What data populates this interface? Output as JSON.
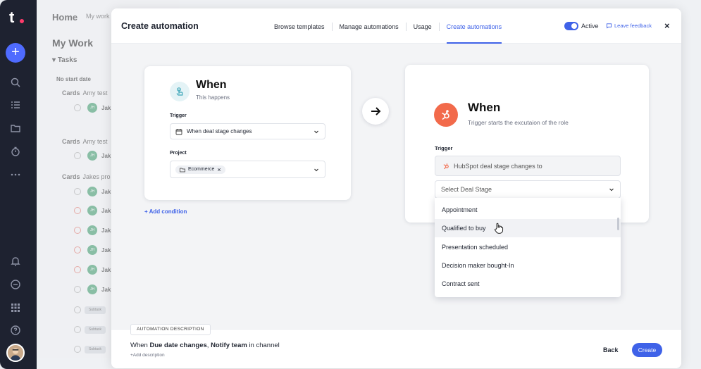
{
  "rail": {
    "logo": "t",
    "plus": "+"
  },
  "background": {
    "home": "Home",
    "my_work_tab": "My work",
    "title": "My Work",
    "tasks_label": "Tasks",
    "no_start_date": "No start date",
    "groups": [
      {
        "label": "Cards",
        "owner": "Amy test"
      },
      {
        "label": "Cards",
        "owner": "Amy test"
      },
      {
        "label": "Cards",
        "owner": "Jakes pro"
      }
    ],
    "initials": "JH",
    "jak": "Jak",
    "subtask": "Subtask"
  },
  "modal": {
    "title": "Create automation",
    "tabs": [
      "Browse templates",
      "Manage automations",
      "Usage",
      "Create automations"
    ],
    "active_tab": "Create automations",
    "active_label": "Active",
    "feedback_label": "Leave feedback",
    "close": "×"
  },
  "when_card": {
    "title": "When",
    "subtitle": "This happens",
    "trigger_label": "Trigger",
    "trigger_value": "When deal stage changes",
    "project_label": "Project",
    "project_chip": "Ecommerce",
    "add_condition": "+ Add condition"
  },
  "hubspot_card": {
    "title": "When",
    "subtitle": "Trigger starts the excutaion of the role",
    "trigger_label": "Trigger",
    "trigger_value": "HubSpot deal stage changes to",
    "select_placeholder": "Select Deal Stage"
  },
  "dropdown": {
    "options": [
      "Appointment",
      "Qualified to buy",
      "Presentation scheduled",
      "Decision maker bought-In",
      "Contract sent"
    ],
    "hovered": "Qualified to buy"
  },
  "footer": {
    "tag": "AUTOMATION DESCRIPTION",
    "desc_prefix": "When",
    "desc_trigger": "Due date changes",
    "desc_sep": ",",
    "desc_action": "Notify team",
    "desc_suffix": "in channel",
    "add_description": "+Add description",
    "back": "Back",
    "create": "Create"
  },
  "colors": {
    "accent": "#3f62e8",
    "hubspot": "#f26a4b",
    "rail": "#1e2230"
  }
}
